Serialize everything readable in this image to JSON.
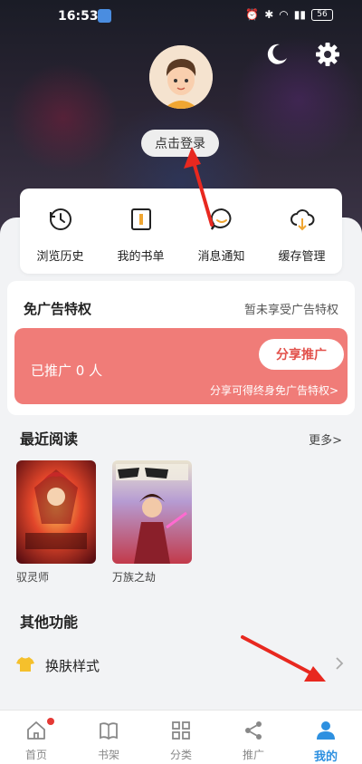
{
  "status_bar": {
    "time": "16:53",
    "battery": "56"
  },
  "profile": {
    "login_label": "点击登录"
  },
  "quick_actions": [
    {
      "label": "浏览历史",
      "icon": "history-icon"
    },
    {
      "label": "我的书单",
      "icon": "booklist-icon"
    },
    {
      "label": "消息通知",
      "icon": "message-icon"
    },
    {
      "label": "缓存管理",
      "icon": "cloud-download-icon"
    }
  ],
  "ad_free": {
    "title": "免广告特权",
    "status": "暂未享受广告特权",
    "promoted": "已推广 0 人",
    "share_button": "分享推广",
    "note": "分享可得终身免广告特权>"
  },
  "recent": {
    "title": "最近阅读",
    "more": "更多>",
    "books": [
      {
        "title": "驭灵师"
      },
      {
        "title": "万族之劫"
      }
    ]
  },
  "other": {
    "title": "其他功能",
    "skin_label": "换肤样式"
  },
  "tabs": [
    {
      "label": "首页",
      "icon": "home-icon"
    },
    {
      "label": "书架",
      "icon": "bookshelf-icon"
    },
    {
      "label": "分类",
      "icon": "category-icon"
    },
    {
      "label": "推广",
      "icon": "share-icon"
    },
    {
      "label": "我的",
      "icon": "user-icon"
    }
  ],
  "colors": {
    "accent": "#2d90e0",
    "promo_banner": "#f07c78",
    "annotation_arrow": "#e8281f"
  }
}
